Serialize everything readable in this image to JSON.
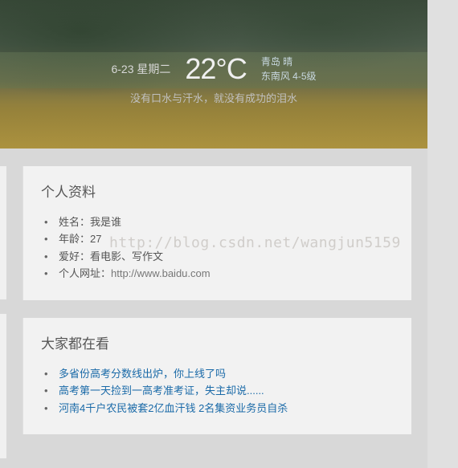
{
  "hero": {
    "date": "6-23 星期二",
    "temperature": "22°C",
    "location": "青岛 晴",
    "wind": "东南风 4-5级",
    "quote": "没有口水与汗水，就没有成功的泪水"
  },
  "watermark": "http://blog.csdn.net/wangjun5159",
  "profile": {
    "title": "个人资料",
    "items": [
      {
        "label": "姓名：",
        "value": "我是谁"
      },
      {
        "label": "年龄：",
        "value": "27"
      },
      {
        "label": "爱好：",
        "value": "看电影、写作文"
      },
      {
        "label": "个人网址：",
        "value": "http://www.baidu.com",
        "isLink": true
      }
    ]
  },
  "hotlist": {
    "title": "大家都在看",
    "items": [
      "多省份高考分数线出炉，你上线了吗",
      "高考第一天捡到一高考准考证，失主却说......",
      "河南4千户农民被套2亿血汗钱 2名集资业务员自杀"
    ]
  }
}
